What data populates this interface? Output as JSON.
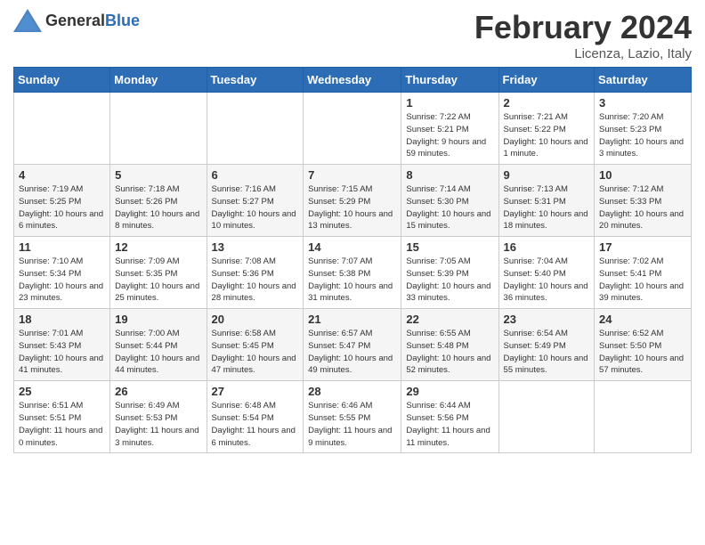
{
  "logo": {
    "general": "General",
    "blue": "Blue"
  },
  "title": "February 2024",
  "subtitle": "Licenza, Lazio, Italy",
  "days_header": [
    "Sunday",
    "Monday",
    "Tuesday",
    "Wednesday",
    "Thursday",
    "Friday",
    "Saturday"
  ],
  "weeks": [
    [
      {
        "day": "",
        "info": ""
      },
      {
        "day": "",
        "info": ""
      },
      {
        "day": "",
        "info": ""
      },
      {
        "day": "",
        "info": ""
      },
      {
        "day": "1",
        "info": "Sunrise: 7:22 AM\nSunset: 5:21 PM\nDaylight: 9 hours and 59 minutes."
      },
      {
        "day": "2",
        "info": "Sunrise: 7:21 AM\nSunset: 5:22 PM\nDaylight: 10 hours and 1 minute."
      },
      {
        "day": "3",
        "info": "Sunrise: 7:20 AM\nSunset: 5:23 PM\nDaylight: 10 hours and 3 minutes."
      }
    ],
    [
      {
        "day": "4",
        "info": "Sunrise: 7:19 AM\nSunset: 5:25 PM\nDaylight: 10 hours and 6 minutes."
      },
      {
        "day": "5",
        "info": "Sunrise: 7:18 AM\nSunset: 5:26 PM\nDaylight: 10 hours and 8 minutes."
      },
      {
        "day": "6",
        "info": "Sunrise: 7:16 AM\nSunset: 5:27 PM\nDaylight: 10 hours and 10 minutes."
      },
      {
        "day": "7",
        "info": "Sunrise: 7:15 AM\nSunset: 5:29 PM\nDaylight: 10 hours and 13 minutes."
      },
      {
        "day": "8",
        "info": "Sunrise: 7:14 AM\nSunset: 5:30 PM\nDaylight: 10 hours and 15 minutes."
      },
      {
        "day": "9",
        "info": "Sunrise: 7:13 AM\nSunset: 5:31 PM\nDaylight: 10 hours and 18 minutes."
      },
      {
        "day": "10",
        "info": "Sunrise: 7:12 AM\nSunset: 5:33 PM\nDaylight: 10 hours and 20 minutes."
      }
    ],
    [
      {
        "day": "11",
        "info": "Sunrise: 7:10 AM\nSunset: 5:34 PM\nDaylight: 10 hours and 23 minutes."
      },
      {
        "day": "12",
        "info": "Sunrise: 7:09 AM\nSunset: 5:35 PM\nDaylight: 10 hours and 25 minutes."
      },
      {
        "day": "13",
        "info": "Sunrise: 7:08 AM\nSunset: 5:36 PM\nDaylight: 10 hours and 28 minutes."
      },
      {
        "day": "14",
        "info": "Sunrise: 7:07 AM\nSunset: 5:38 PM\nDaylight: 10 hours and 31 minutes."
      },
      {
        "day": "15",
        "info": "Sunrise: 7:05 AM\nSunset: 5:39 PM\nDaylight: 10 hours and 33 minutes."
      },
      {
        "day": "16",
        "info": "Sunrise: 7:04 AM\nSunset: 5:40 PM\nDaylight: 10 hours and 36 minutes."
      },
      {
        "day": "17",
        "info": "Sunrise: 7:02 AM\nSunset: 5:41 PM\nDaylight: 10 hours and 39 minutes."
      }
    ],
    [
      {
        "day": "18",
        "info": "Sunrise: 7:01 AM\nSunset: 5:43 PM\nDaylight: 10 hours and 41 minutes."
      },
      {
        "day": "19",
        "info": "Sunrise: 7:00 AM\nSunset: 5:44 PM\nDaylight: 10 hours and 44 minutes."
      },
      {
        "day": "20",
        "info": "Sunrise: 6:58 AM\nSunset: 5:45 PM\nDaylight: 10 hours and 47 minutes."
      },
      {
        "day": "21",
        "info": "Sunrise: 6:57 AM\nSunset: 5:47 PM\nDaylight: 10 hours and 49 minutes."
      },
      {
        "day": "22",
        "info": "Sunrise: 6:55 AM\nSunset: 5:48 PM\nDaylight: 10 hours and 52 minutes."
      },
      {
        "day": "23",
        "info": "Sunrise: 6:54 AM\nSunset: 5:49 PM\nDaylight: 10 hours and 55 minutes."
      },
      {
        "day": "24",
        "info": "Sunrise: 6:52 AM\nSunset: 5:50 PM\nDaylight: 10 hours and 57 minutes."
      }
    ],
    [
      {
        "day": "25",
        "info": "Sunrise: 6:51 AM\nSunset: 5:51 PM\nDaylight: 11 hours and 0 minutes."
      },
      {
        "day": "26",
        "info": "Sunrise: 6:49 AM\nSunset: 5:53 PM\nDaylight: 11 hours and 3 minutes."
      },
      {
        "day": "27",
        "info": "Sunrise: 6:48 AM\nSunset: 5:54 PM\nDaylight: 11 hours and 6 minutes."
      },
      {
        "day": "28",
        "info": "Sunrise: 6:46 AM\nSunset: 5:55 PM\nDaylight: 11 hours and 9 minutes."
      },
      {
        "day": "29",
        "info": "Sunrise: 6:44 AM\nSunset: 5:56 PM\nDaylight: 11 hours and 11 minutes."
      },
      {
        "day": "",
        "info": ""
      },
      {
        "day": "",
        "info": ""
      }
    ]
  ]
}
